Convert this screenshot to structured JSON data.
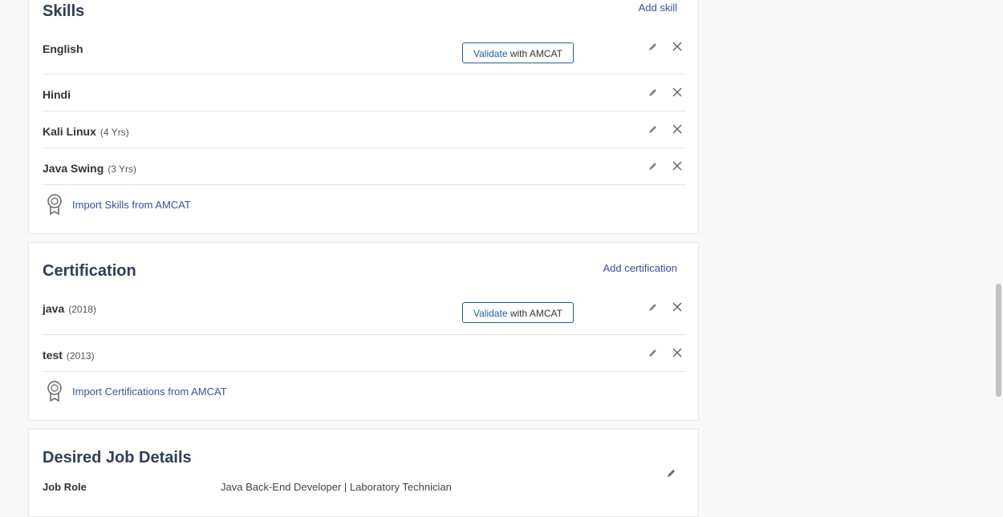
{
  "skills": {
    "title": "Skills",
    "add_label": "Add skill",
    "items": [
      {
        "name": "English",
        "meta": ""
      },
      {
        "name": "Hindi",
        "meta": ""
      },
      {
        "name": "Kali Linux",
        "meta": "(4 Yrs)"
      },
      {
        "name": "Java Swing",
        "meta": "(3 Yrs)"
      }
    ],
    "validate_prefix": "Validate",
    "validate_suffix": " with AMCAT",
    "import_label": "Import Skills from AMCAT"
  },
  "certification": {
    "title": "Certification",
    "add_label": "Add certification",
    "items": [
      {
        "name": "java",
        "meta": "(2018)"
      },
      {
        "name": "test",
        "meta": "(2013)"
      }
    ],
    "validate_prefix": "Validate",
    "validate_suffix": " with AMCAT",
    "import_label": "Import Certifications from AMCAT"
  },
  "desired_job": {
    "title": "Desired Job Details",
    "job_role_label": "Job Role",
    "job_role_value": "Java Back-End Developer | Laboratory Technician"
  },
  "icons": {
    "edit": "pencil-icon",
    "delete": "close-icon",
    "import": "award-badge-icon"
  },
  "colors": {
    "link": "#3b4fa8",
    "title": "#2f3e57",
    "validate_border": "#2a5c8a"
  }
}
